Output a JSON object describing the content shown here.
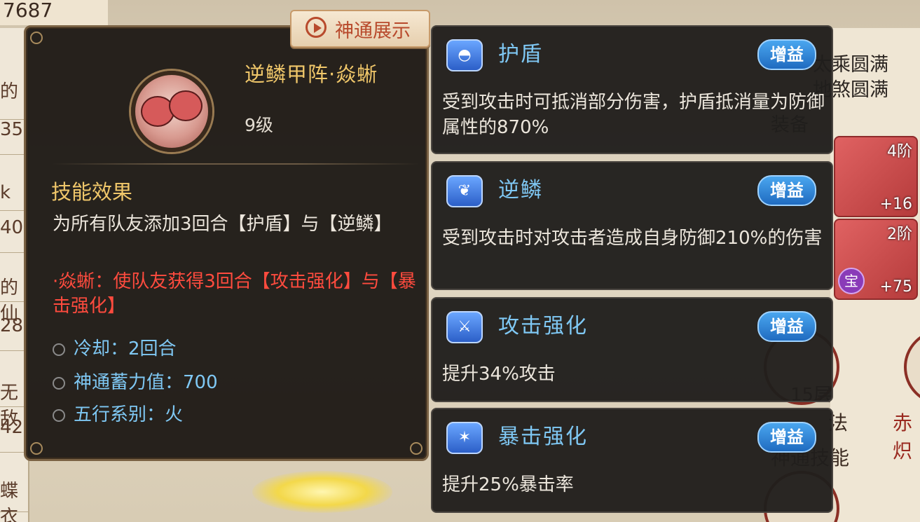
{
  "background": {
    "top_left_text": "7687",
    "left_column": [
      "的",
      "35",
      "k",
      "40",
      "的仙",
      "28",
      "无敌",
      "42",
      "蝶衣"
    ],
    "right_texts": [
      "太乘圆满",
      "地煞圆满",
      "装备",
      "神通技能",
      "15层",
      "赤炽",
      "法"
    ],
    "items": [
      {
        "tier": "4阶",
        "plus": "+16"
      },
      {
        "tier": "2阶",
        "plus": "+75",
        "badge": "宝"
      }
    ]
  },
  "skill": {
    "show_button": "神通展示",
    "name": "逆鳞甲阵·焱蜥",
    "level": "9级",
    "section_title": "技能效果",
    "description": "为所有队友添加3回合【护盾】与【逆鳞】",
    "bonus_text": "·焱蜥：使队友获得3回合【攻击强化】与【暴击强化】",
    "attributes": [
      {
        "text": "冷却：2回合"
      },
      {
        "text": "神通蓄力值：700"
      },
      {
        "text": "五行系别：火"
      }
    ]
  },
  "buffs": [
    {
      "title": "护盾",
      "tag": "增益",
      "icon": "shield-icon",
      "text": "受到攻击时可抵消部分伤害，护盾抵消量为防御属性的870%"
    },
    {
      "title": "逆鳞",
      "tag": "增益",
      "icon": "scale-icon",
      "text": "受到攻击时对攻击者造成自身防御210%的伤害"
    },
    {
      "title": "攻击强化",
      "tag": "增益",
      "icon": "sword-icon",
      "text": "提升34%攻击"
    },
    {
      "title": "暴击强化",
      "tag": "增益",
      "icon": "crit-icon",
      "text": "提升25%暴击率"
    }
  ],
  "colors": {
    "gold": "#f0c76a",
    "blue": "#7fc8f4",
    "red": "#ff4b3e",
    "tag_blue": "#1f6bc0"
  }
}
